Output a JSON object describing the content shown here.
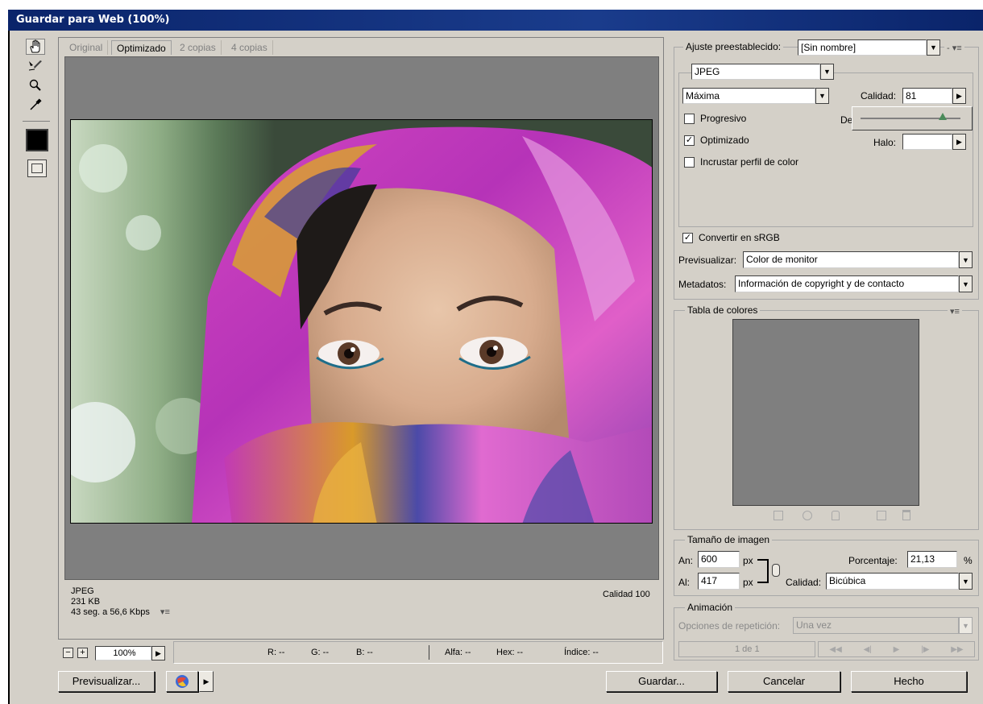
{
  "window": {
    "title": "Guardar para Web (100%)"
  },
  "tabs": [
    {
      "label": "Original"
    },
    {
      "label": "Optimizado"
    },
    {
      "label": "2 copias"
    },
    {
      "label": "4 copias"
    }
  ],
  "image_info": {
    "format": "JPEG",
    "size": "231 KB",
    "download": "43 seg. a 56,6 Kbps",
    "quality": "Calidad 100"
  },
  "status": {
    "zoom": "100%",
    "r": "R: --",
    "g": "G: --",
    "b": "B: --",
    "alpha": "Alfa: --",
    "hex": "Hex: --",
    "index": "Índice: --"
  },
  "settings": {
    "preset_label": "Ajuste preestablecido:",
    "preset_value": "[Sin nombre]",
    "format_value": "JPEG",
    "compression_value": "Máxima",
    "quality_label": "Calidad:",
    "quality_value": "81",
    "blur_label_partial": "De",
    "halo_label": "Halo:",
    "progressive_label": "Progresivo",
    "optimized_label": "Optimizado",
    "embed_profile_label": "Incrustar perfil de color",
    "convert_srgb_label": "Convertir en sRGB",
    "preview_label": "Previsualizar:",
    "preview_value": "Color de monitor",
    "metadata_label": "Metadatos:",
    "metadata_value": "Información de copyright y de contacto",
    "quality_slider": 0.82
  },
  "color_table": {
    "title": "Tabla de colores"
  },
  "image_size": {
    "title": "Tamaño de imagen",
    "width_label": "An:",
    "width_value": "600",
    "height_label": "Al:",
    "height_value": "417",
    "unit": "px",
    "percent_label": "Porcentaje:",
    "percent_value": "21,13",
    "percent_unit": "%",
    "quality_label": "Calidad:",
    "quality_value": "Bicúbica"
  },
  "animation": {
    "title": "Animación",
    "repeat_label": "Opciones de repetición:",
    "repeat_value": "Una vez",
    "frame_counter": "1 de 1"
  },
  "buttons": {
    "preview": "Previsualizar...",
    "save": "Guardar...",
    "cancel": "Cancelar",
    "done": "Hecho"
  }
}
